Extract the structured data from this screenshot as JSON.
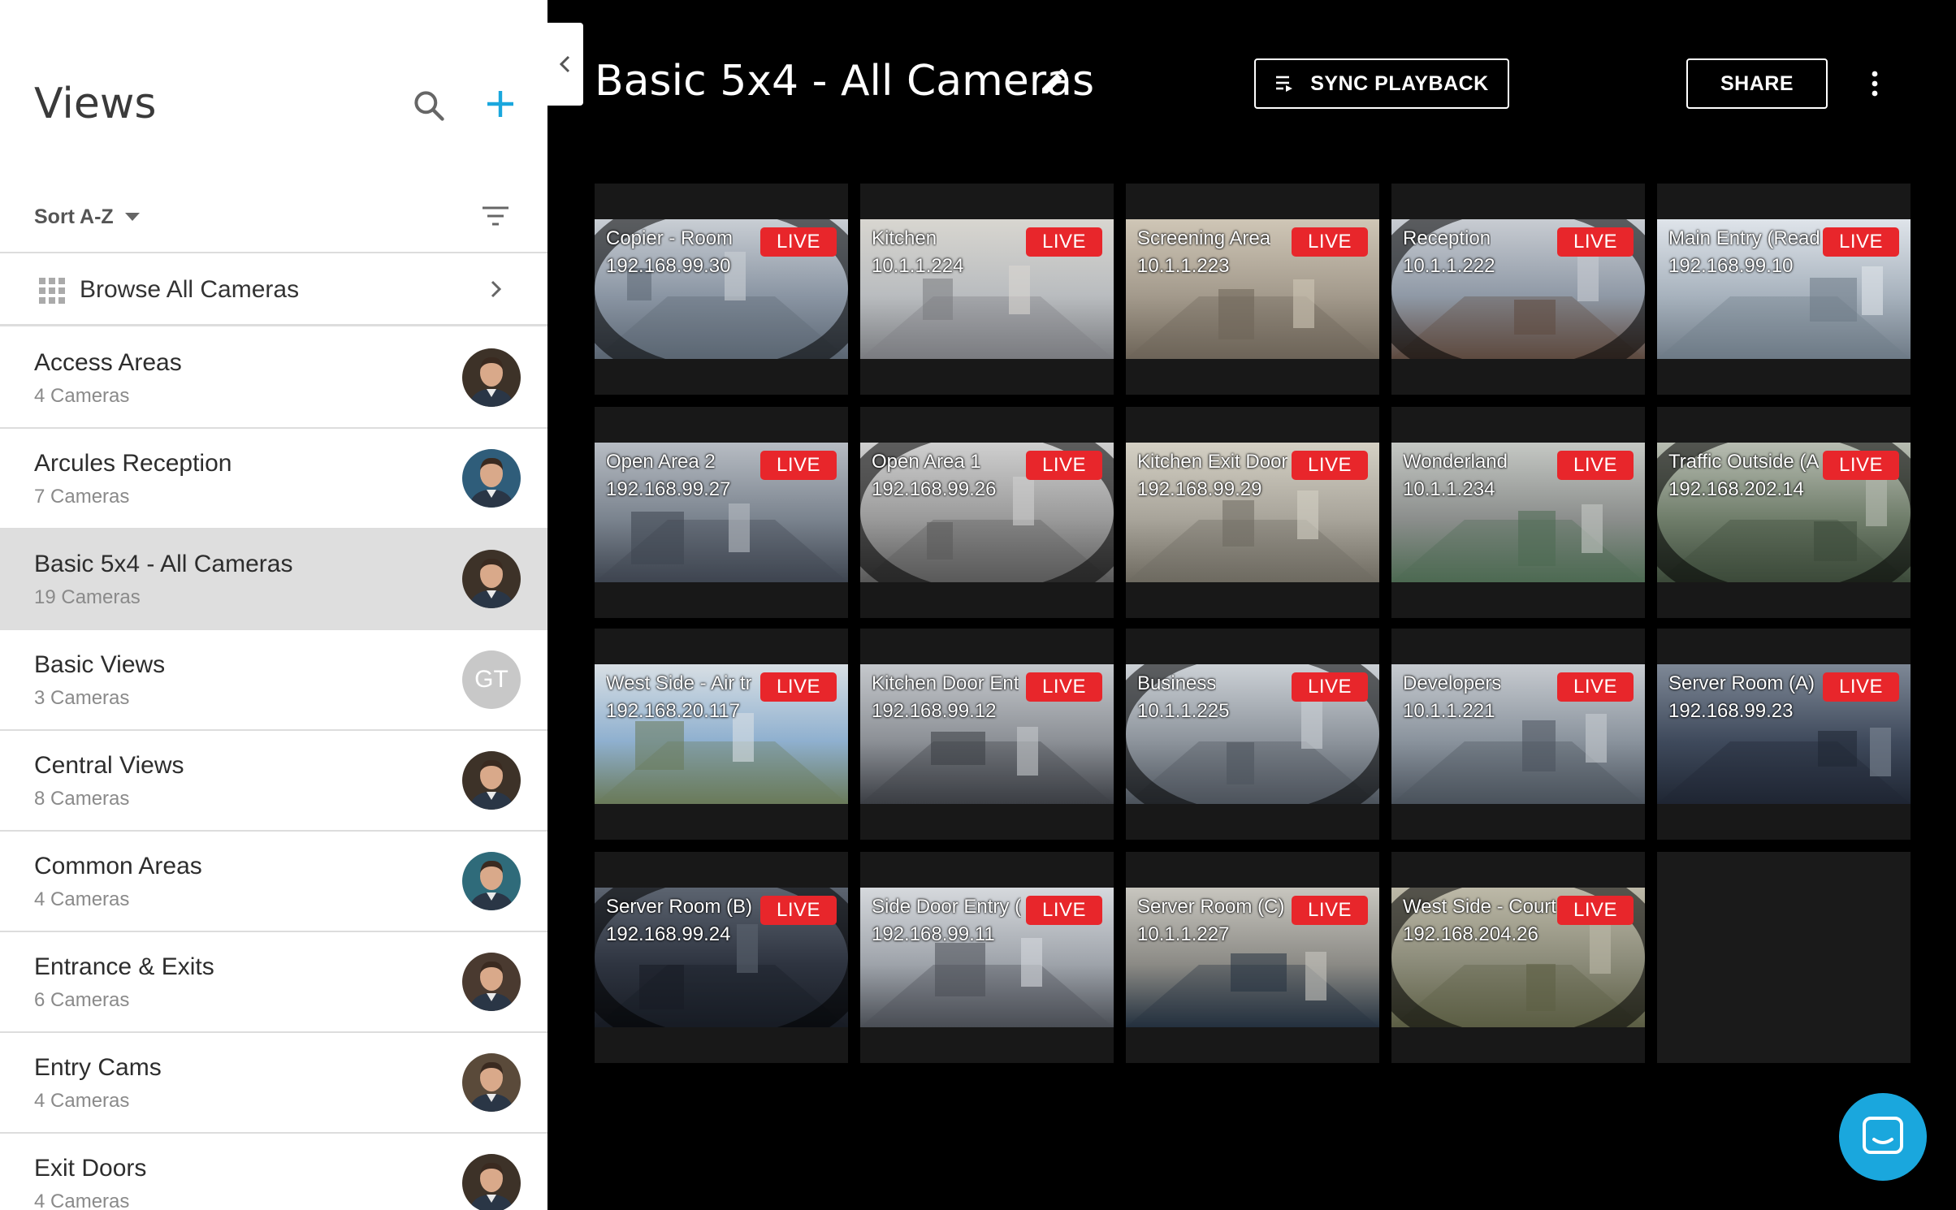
{
  "sidebar": {
    "title": "Views",
    "sort_label": "Sort A-Z",
    "browse_label": "Browse All Cameras",
    "views": [
      {
        "name": "Access Areas",
        "count": "4 Cameras",
        "avatar": "photo",
        "active": false
      },
      {
        "name": "Arcules Reception",
        "count": "7 Cameras",
        "avatar": "photo",
        "active": false
      },
      {
        "name": "Basic 5x4 - All Cameras",
        "count": "19 Cameras",
        "avatar": "photo",
        "active": true
      },
      {
        "name": "Basic Views",
        "count": "3 Cameras",
        "avatar": "GT",
        "active": false
      },
      {
        "name": "Central Views",
        "count": "8 Cameras",
        "avatar": "photo",
        "active": false
      },
      {
        "name": "Common Areas",
        "count": "4 Cameras",
        "avatar": "photo",
        "active": false
      },
      {
        "name": "Entrance & Exits",
        "count": "6 Cameras",
        "avatar": "photo",
        "active": false
      },
      {
        "name": "Entry Cams",
        "count": "4 Cameras",
        "avatar": "photo",
        "active": false
      },
      {
        "name": "Exit Doors",
        "count": "4 Cameras",
        "avatar": "photo",
        "active": false
      }
    ]
  },
  "header": {
    "title": "Basic 5x4 - All Cameras",
    "sync_label": "SYNC PLAYBACK",
    "share_label": "SHARE"
  },
  "live_label": "LIVE",
  "cameras": [
    {
      "name": "Copier - Room",
      "ip": "192.168.99.30",
      "palette": [
        "#8a95a3",
        "#c9ced4",
        "#5b6673"
      ]
    },
    {
      "name": "Kitchen",
      "ip": "10.1.1.224",
      "palette": [
        "#b9bcbf",
        "#d8d6d0",
        "#7a7c80"
      ]
    },
    {
      "name": "Screening Area",
      "ip": "10.1.1.223",
      "palette": [
        "#a39a8c",
        "#cfc6b6",
        "#6d6458"
      ]
    },
    {
      "name": "Reception",
      "ip": "10.1.1.222",
      "palette": [
        "#8f99a6",
        "#c8ccd2",
        "#5e4a40"
      ]
    },
    {
      "name": "Main Entry (Read",
      "ip": "192.168.99.10",
      "palette": [
        "#a7b2bd",
        "#dfe4ea",
        "#6e7a86"
      ]
    },
    {
      "name": "Open Area 2",
      "ip": "192.168.99.27",
      "palette": [
        "#7a838e",
        "#b7bcc3",
        "#3e4550"
      ]
    },
    {
      "name": "Open Area 1",
      "ip": "192.168.99.26",
      "palette": [
        "#9a9a9a",
        "#cfcfcf",
        "#5a5a5a"
      ]
    },
    {
      "name": "Kitchen Exit Door",
      "ip": "192.168.99.29",
      "palette": [
        "#a8a49a",
        "#d4d0c4",
        "#6e6a60"
      ]
    },
    {
      "name": "Wonderland",
      "ip": "10.1.1.234",
      "palette": [
        "#8b8e8c",
        "#c5c8c4",
        "#4d6a52"
      ]
    },
    {
      "name": "Traffic Outside (A",
      "ip": "192.168.202.14",
      "palette": [
        "#6f7d6a",
        "#b8bdb2",
        "#3c4a3a"
      ]
    },
    {
      "name": "West Side - Air tr",
      "ip": "192.168.20.117",
      "palette": [
        "#8fb0cf",
        "#d8dfe4",
        "#6a7a5a"
      ]
    },
    {
      "name": "Kitchen Door Ent",
      "ip": "192.168.99.12",
      "palette": [
        "#8c9096",
        "#c5c8cc",
        "#3b3e44"
      ]
    },
    {
      "name": "Business",
      "ip": "10.1.1.225",
      "palette": [
        "#8d949c",
        "#ccd1d6",
        "#4c535c"
      ]
    },
    {
      "name": "Developers",
      "ip": "10.1.1.221",
      "palette": [
        "#8a939d",
        "#c7cbd0",
        "#4a525c"
      ]
    },
    {
      "name": "Server Room (A)",
      "ip": "192.168.99.23",
      "palette": [
        "#3f4a5c",
        "#7e8896",
        "#1f2633"
      ]
    },
    {
      "name": "Server Room (B)",
      "ip": "192.168.99.24",
      "palette": [
        "#2e3440",
        "#5c6470",
        "#181c24"
      ]
    },
    {
      "name": "Side Door Entry (",
      "ip": "192.168.99.11",
      "palette": [
        "#9ea3aa",
        "#d6d9dd",
        "#4a4e55"
      ]
    },
    {
      "name": "Server Room (C)",
      "ip": "10.1.1.227",
      "palette": [
        "#8b8a85",
        "#c8c6bf",
        "#24313f"
      ]
    },
    {
      "name": "West Side - Court",
      "ip": "192.168.204.26",
      "palette": [
        "#8a8a78",
        "#bdb9a8",
        "#5c5e44"
      ]
    }
  ]
}
